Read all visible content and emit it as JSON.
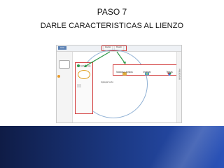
{
  "slide": {
    "title": "PASO 7",
    "subtitle": "DARLE CARACTERISTICAS AL LIENZO"
  },
  "screenshot": {
    "home_label": "Inicio",
    "tabs": [
      "Insertar",
      "Diseño"
    ],
    "property_label": "Editar más",
    "canvas_text": "Agregar texto",
    "toolbar": [
      {
        "label": "Marcos y fondos",
        "icon": "frames-icon"
      },
      {
        "label": "Insertar",
        "icon": "insert-icon"
      },
      {
        "label": "Temas",
        "icon": "themes-icon"
      }
    ],
    "side_text": "PRESENTAR"
  },
  "colors": {
    "highlight": "#d23b3b",
    "arrow": "#2f9a4a",
    "band_dark": "#0f1c46",
    "band_light": "#2a52b8"
  }
}
